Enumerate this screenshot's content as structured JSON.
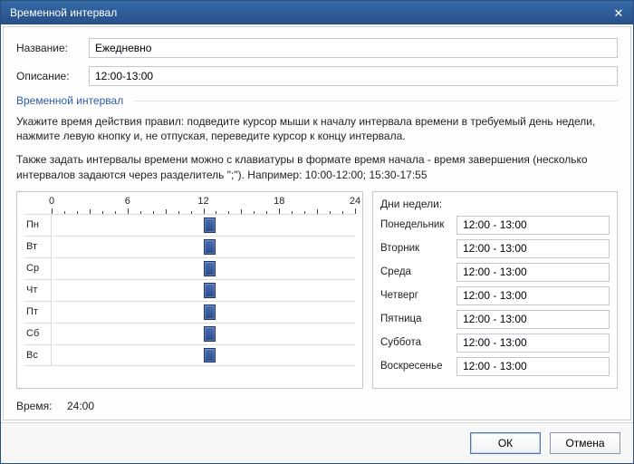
{
  "window": {
    "title": "Временной интервал"
  },
  "form": {
    "name_label": "Название:",
    "name_value": "Ежедневно",
    "desc_label": "Описание:",
    "desc_value": "12:00-13:00"
  },
  "section_title": "Временной интервал",
  "help_line1": "Укажите время действия правил: подведите курсор мыши к началу интервала времени в требуемый день недели, нажмите левую кнопку и, не отпуская, переведите курсор к концу интервала.",
  "help_line2": "Также задать интервалы времени можно с клавиатуры в формате время начала - время завершения (несколько интервалов задаются через разделитель \";\"). Например: 10:00-12:00; 15:30-17:55",
  "ruler_labels": [
    "0",
    "6",
    "12",
    "18",
    "24"
  ],
  "days_short": [
    "Пн",
    "Вт",
    "Ср",
    "Чт",
    "Пт",
    "Сб",
    "Вс"
  ],
  "days_side": {
    "header": "Дни недели:",
    "rows": [
      {
        "name": "Понедельник",
        "value": "12:00 - 13:00"
      },
      {
        "name": "Вторник",
        "value": "12:00 - 13:00"
      },
      {
        "name": "Среда",
        "value": "12:00 - 13:00"
      },
      {
        "name": "Четверг",
        "value": "12:00 - 13:00"
      },
      {
        "name": "Пятница",
        "value": "12:00 - 13:00"
      },
      {
        "name": "Суббота",
        "value": "12:00 - 13:00"
      },
      {
        "name": "Воскресенье",
        "value": "12:00 - 13:00"
      }
    ]
  },
  "chart_data": {
    "type": "bar",
    "xlabel": "",
    "ylabel": "",
    "xlim": [
      0,
      24
    ],
    "categories": [
      "Пн",
      "Вт",
      "Ср",
      "Чт",
      "Пт",
      "Сб",
      "Вс"
    ],
    "series": [
      {
        "name": "interval",
        "ranges": [
          [
            12,
            13
          ],
          [
            12,
            13
          ],
          [
            12,
            13
          ],
          [
            12,
            13
          ],
          [
            12,
            13
          ],
          [
            12,
            13
          ],
          [
            12,
            13
          ]
        ]
      }
    ]
  },
  "time_status": {
    "label": "Время:",
    "value": "24:00"
  },
  "buttons": {
    "ok": "ОК",
    "cancel": "Отмена"
  }
}
